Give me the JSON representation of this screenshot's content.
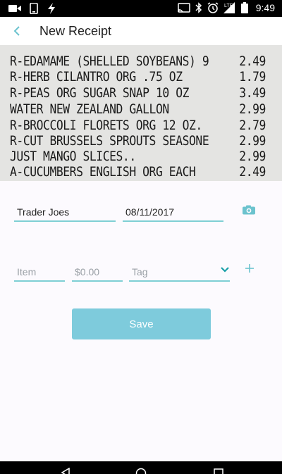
{
  "status_bar": {
    "time": "9:49",
    "icons": [
      "video-camera-icon",
      "phone-icon",
      "flash-icon",
      "cast-icon",
      "bluetooth-icon",
      "alarm-icon",
      "signal-lte-icon",
      "battery-icon"
    ],
    "network_label": "LTE"
  },
  "app_bar": {
    "title": "New Receipt",
    "back_icon": "chevron-left-icon",
    "accent_color": "#7ecfd4"
  },
  "receipt": {
    "lines": [
      {
        "desc": "R-EDAMAME (SHELLED SOYBEANS) 9",
        "price": "2.49"
      },
      {
        "desc": "R-HERB CILANTRO ORG .75 OZ",
        "price": "1.79"
      },
      {
        "desc": "R-PEAS ORG SUGAR SNAP 10 OZ",
        "price": "3.49"
      },
      {
        "desc": "WATER NEW ZEALAND GALLON",
        "price": "2.99"
      },
      {
        "desc": "R-BROCCOLI FLORETS ORG 12 OZ.",
        "price": "2.79"
      },
      {
        "desc": "R-CUT BRUSSELS SPROUTS SEASONE",
        "price": "2.99"
      },
      {
        "desc": "JUST MANGO SLICES..",
        "price": "2.99"
      },
      {
        "desc": "A-CUCUMBERS ENGLISH ORG EACH",
        "price": "2.49"
      }
    ]
  },
  "form": {
    "store": {
      "value": "Trader Joes"
    },
    "date": {
      "value": "08/11/2017"
    },
    "item": {
      "placeholder": "Item"
    },
    "amount": {
      "placeholder": "$0.00"
    },
    "tag": {
      "placeholder": "Tag"
    },
    "camera_icon": "camera-icon",
    "tag_dropdown_icon": "chevron-down-icon",
    "add_icon": "plus-icon",
    "save_label": "Save",
    "save_color": "#7ecbdc"
  }
}
